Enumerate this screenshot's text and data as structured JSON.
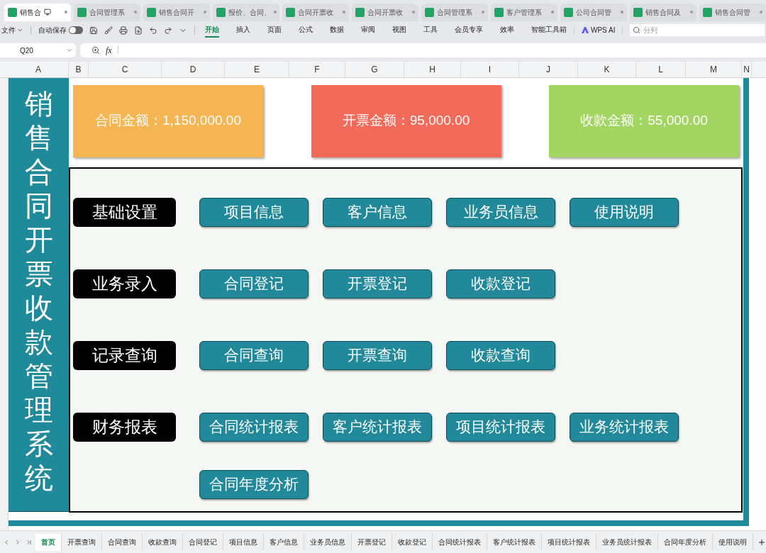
{
  "file_tabs": [
    {
      "label": "销售合",
      "selected": true
    },
    {
      "label": "合同管理系",
      "selected": false
    },
    {
      "label": "销售合同开",
      "selected": false
    },
    {
      "label": "报价、合同、",
      "selected": false
    },
    {
      "label": "合同开票收",
      "selected": false
    },
    {
      "label": "合同开票收",
      "selected": false
    },
    {
      "label": "合同管理系",
      "selected": false
    },
    {
      "label": "客户管理系",
      "selected": false
    },
    {
      "label": "公司合同管",
      "selected": false
    },
    {
      "label": "销售合同及",
      "selected": false
    },
    {
      "label": "销售合同管",
      "selected": false
    }
  ],
  "toolbar": {
    "file_menu": "文件",
    "autosave": {
      "label": "自动保存",
      "on": false
    },
    "ribbon_tabs": [
      {
        "label": "开始",
        "selected": true
      },
      {
        "label": "插入",
        "selected": false
      },
      {
        "label": "页面",
        "selected": false
      },
      {
        "label": "公式",
        "selected": false
      },
      {
        "label": "数据",
        "selected": false
      },
      {
        "label": "审阅",
        "selected": false
      },
      {
        "label": "视图",
        "selected": false
      },
      {
        "label": "工具",
        "selected": false
      },
      {
        "label": "会员专享",
        "selected": false
      },
      {
        "label": "效率",
        "selected": false
      },
      {
        "label": "智能工具箱",
        "selected": false
      }
    ],
    "ai_button": "WPS AI",
    "search": {
      "placeholder": "分列"
    }
  },
  "formula_bar": {
    "cell": "Q20",
    "fx": "fx"
  },
  "columns": [
    "A",
    "B",
    "C",
    "D",
    "E",
    "F",
    "G",
    "H",
    "I",
    "J",
    "K",
    "L",
    "M",
    "N"
  ],
  "dashboard": {
    "title": "销售合同开票收款管理系统",
    "cards": [
      {
        "label": "合同金额：1,150,000.00",
        "color": "#f4b552"
      },
      {
        "label": "开票金额：95,000.00",
        "color": "#f26a5a"
      },
      {
        "label": "收款金额：55,000.00",
        "color": "#a3d563"
      }
    ],
    "sections": [
      {
        "label": "基础设置",
        "buttons": [
          "项目信息",
          "客户信息",
          "业务员信息",
          "使用说明"
        ]
      },
      {
        "label": "业务录入",
        "buttons": [
          "合同登记",
          "开票登记",
          "收款登记"
        ]
      },
      {
        "label": "记录查询",
        "buttons": [
          "合同查询",
          "开票查询",
          "收款查询"
        ]
      },
      {
        "label": "财务报表",
        "buttons": [
          "合同统计报表",
          "客户统计报表",
          "项目统计报表",
          "业务统计报表",
          "合同年度分析"
        ]
      }
    ]
  },
  "sheet_tabs": [
    {
      "label": "首页",
      "selected": true
    },
    {
      "label": "开票查询",
      "selected": false
    },
    {
      "label": "合同查询",
      "selected": false
    },
    {
      "label": "收款查询",
      "selected": false
    },
    {
      "label": "合同登记",
      "selected": false
    },
    {
      "label": "项目信息",
      "selected": false
    },
    {
      "label": "客户信息",
      "selected": false
    },
    {
      "label": "业务员信息",
      "selected": false
    },
    {
      "label": "开票登记",
      "selected": false
    },
    {
      "label": "收款登记",
      "selected": false
    },
    {
      "label": "合同统计报表",
      "selected": false
    },
    {
      "label": "客户统计报表",
      "selected": false
    },
    {
      "label": "项目统计报表",
      "selected": false
    },
    {
      "label": "业务员统计报表",
      "selected": false
    },
    {
      "label": "合同年度分析",
      "selected": false
    },
    {
      "label": "使用说明",
      "selected": false
    }
  ]
}
